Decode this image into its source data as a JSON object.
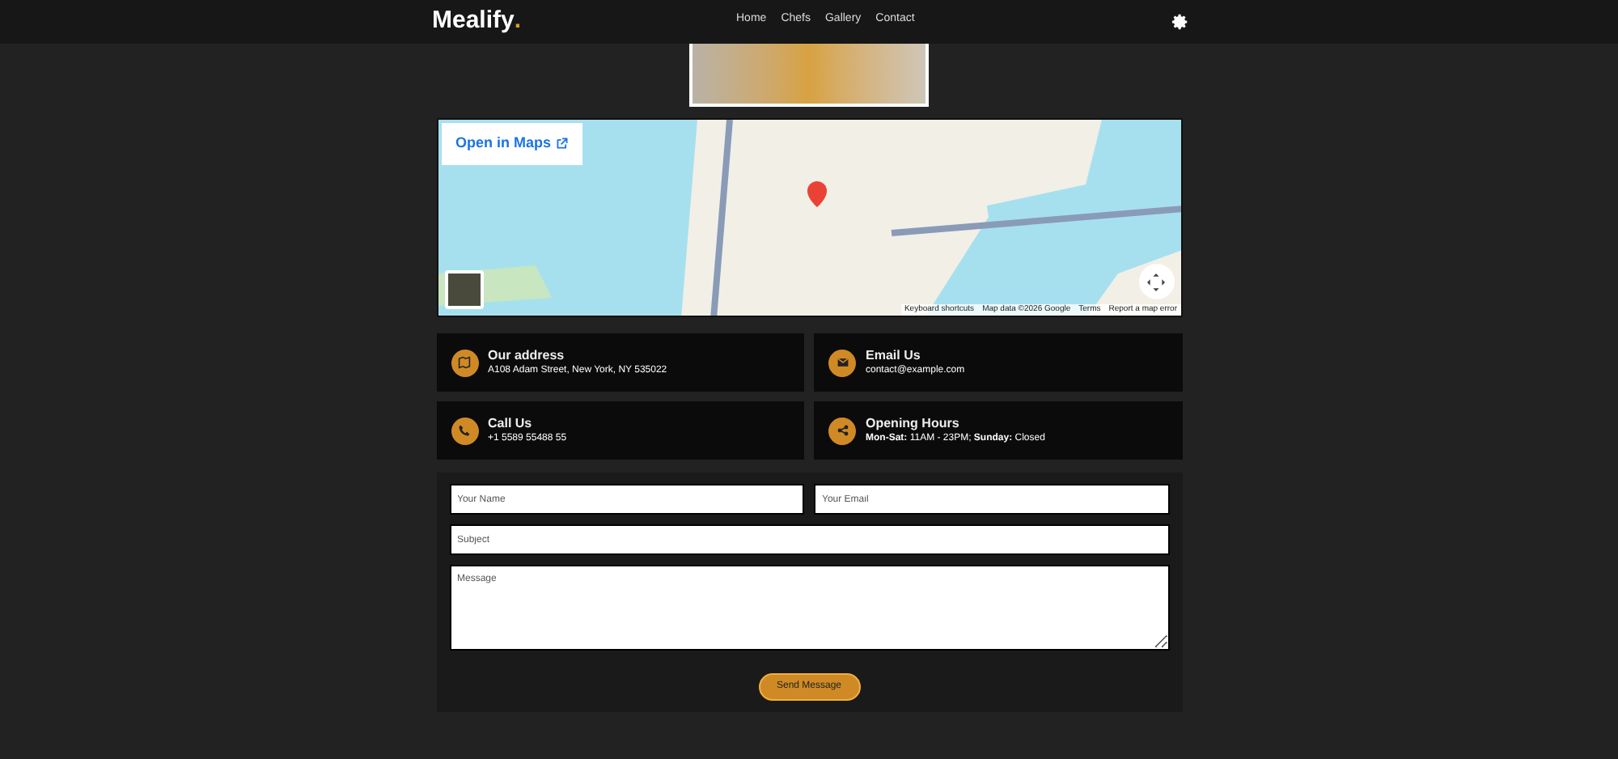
{
  "header": {
    "logo": "Mealify",
    "logo_dot": ".",
    "nav": [
      {
        "label": "Home"
      },
      {
        "label": "Chefs"
      },
      {
        "label": "Gallery"
      },
      {
        "label": "Contact"
      }
    ]
  },
  "map": {
    "open_link": "Open in Maps",
    "attribution": [
      "Keyboard shortcuts",
      "Map data ©2026 Google",
      "Terms",
      "Report a map error"
    ]
  },
  "info_cards": [
    {
      "kind": "address",
      "title": "Our address",
      "text": "A108 Adam Street, New York, NY 535022"
    },
    {
      "kind": "email",
      "title": "Email Us",
      "text": "contact@example.com"
    },
    {
      "kind": "phone",
      "title": "Call Us",
      "text": "+1 5589 55488 55"
    },
    {
      "kind": "hours",
      "title": "Opening Hours",
      "text": "**Mon-Sat:** 11AM - 23PM; **Sunday:** Closed"
    }
  ],
  "form": {
    "name_placeholder": "Your Name",
    "email_placeholder": "Your Email",
    "subject_placeholder": "Subject",
    "message_placeholder": "Message",
    "submit": "Send Message"
  }
}
